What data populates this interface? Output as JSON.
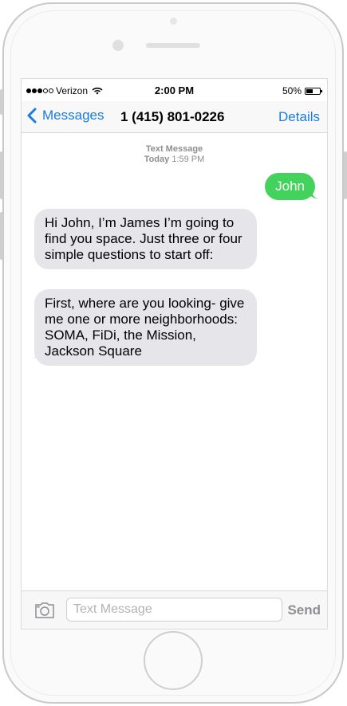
{
  "status": {
    "carrier": "Verizon",
    "time": "2:00 PM",
    "battery_text": "50%",
    "battery_level": 0.5,
    "signal_bars_filled": 3,
    "signal_bars_total": 5
  },
  "navbar": {
    "back_label": "Messages",
    "title": "1 (415) 801-0226",
    "details_label": "Details"
  },
  "thread": {
    "meta_line1": "Text Message",
    "meta_day": "Today",
    "meta_time": "1:59 PM",
    "messages": [
      {
        "direction": "outgoing",
        "text": "John"
      },
      {
        "direction": "incoming",
        "text": "Hi John, I’m James I’m going to find you space. Just three or four simple questions to start off:"
      },
      {
        "direction": "incoming",
        "text": "First, where are you looking- give me one or more neighborhoods: SOMA, FiDi, the Mission, Jackson Square"
      }
    ]
  },
  "input": {
    "placeholder": "Text Message",
    "value": "",
    "send_label": "Send"
  },
  "colors": {
    "accent": "#1a7ce0",
    "outgoing_bubble": "#43d25b",
    "incoming_bubble": "#e5e5ea"
  },
  "icons": [
    "chevron-left-icon",
    "camera-icon",
    "wifi-icon",
    "battery-icon"
  ]
}
